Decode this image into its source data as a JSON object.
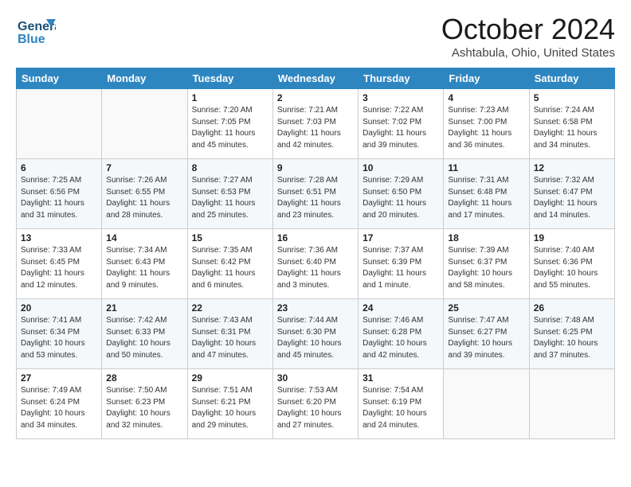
{
  "header": {
    "logo_line1": "General",
    "logo_line2": "Blue",
    "month": "October 2024",
    "location": "Ashtabula, Ohio, United States"
  },
  "weekdays": [
    "Sunday",
    "Monday",
    "Tuesday",
    "Wednesday",
    "Thursday",
    "Friday",
    "Saturday"
  ],
  "weeks": [
    [
      {
        "day": "",
        "sunrise": "",
        "sunset": "",
        "daylight": ""
      },
      {
        "day": "",
        "sunrise": "",
        "sunset": "",
        "daylight": ""
      },
      {
        "day": "1",
        "sunrise": "Sunrise: 7:20 AM",
        "sunset": "Sunset: 7:05 PM",
        "daylight": "Daylight: 11 hours and 45 minutes."
      },
      {
        "day": "2",
        "sunrise": "Sunrise: 7:21 AM",
        "sunset": "Sunset: 7:03 PM",
        "daylight": "Daylight: 11 hours and 42 minutes."
      },
      {
        "day": "3",
        "sunrise": "Sunrise: 7:22 AM",
        "sunset": "Sunset: 7:02 PM",
        "daylight": "Daylight: 11 hours and 39 minutes."
      },
      {
        "day": "4",
        "sunrise": "Sunrise: 7:23 AM",
        "sunset": "Sunset: 7:00 PM",
        "daylight": "Daylight: 11 hours and 36 minutes."
      },
      {
        "day": "5",
        "sunrise": "Sunrise: 7:24 AM",
        "sunset": "Sunset: 6:58 PM",
        "daylight": "Daylight: 11 hours and 34 minutes."
      }
    ],
    [
      {
        "day": "6",
        "sunrise": "Sunrise: 7:25 AM",
        "sunset": "Sunset: 6:56 PM",
        "daylight": "Daylight: 11 hours and 31 minutes."
      },
      {
        "day": "7",
        "sunrise": "Sunrise: 7:26 AM",
        "sunset": "Sunset: 6:55 PM",
        "daylight": "Daylight: 11 hours and 28 minutes."
      },
      {
        "day": "8",
        "sunrise": "Sunrise: 7:27 AM",
        "sunset": "Sunset: 6:53 PM",
        "daylight": "Daylight: 11 hours and 25 minutes."
      },
      {
        "day": "9",
        "sunrise": "Sunrise: 7:28 AM",
        "sunset": "Sunset: 6:51 PM",
        "daylight": "Daylight: 11 hours and 23 minutes."
      },
      {
        "day": "10",
        "sunrise": "Sunrise: 7:29 AM",
        "sunset": "Sunset: 6:50 PM",
        "daylight": "Daylight: 11 hours and 20 minutes."
      },
      {
        "day": "11",
        "sunrise": "Sunrise: 7:31 AM",
        "sunset": "Sunset: 6:48 PM",
        "daylight": "Daylight: 11 hours and 17 minutes."
      },
      {
        "day": "12",
        "sunrise": "Sunrise: 7:32 AM",
        "sunset": "Sunset: 6:47 PM",
        "daylight": "Daylight: 11 hours and 14 minutes."
      }
    ],
    [
      {
        "day": "13",
        "sunrise": "Sunrise: 7:33 AM",
        "sunset": "Sunset: 6:45 PM",
        "daylight": "Daylight: 11 hours and 12 minutes."
      },
      {
        "day": "14",
        "sunrise": "Sunrise: 7:34 AM",
        "sunset": "Sunset: 6:43 PM",
        "daylight": "Daylight: 11 hours and 9 minutes."
      },
      {
        "day": "15",
        "sunrise": "Sunrise: 7:35 AM",
        "sunset": "Sunset: 6:42 PM",
        "daylight": "Daylight: 11 hours and 6 minutes."
      },
      {
        "day": "16",
        "sunrise": "Sunrise: 7:36 AM",
        "sunset": "Sunset: 6:40 PM",
        "daylight": "Daylight: 11 hours and 3 minutes."
      },
      {
        "day": "17",
        "sunrise": "Sunrise: 7:37 AM",
        "sunset": "Sunset: 6:39 PM",
        "daylight": "Daylight: 11 hours and 1 minute."
      },
      {
        "day": "18",
        "sunrise": "Sunrise: 7:39 AM",
        "sunset": "Sunset: 6:37 PM",
        "daylight": "Daylight: 10 hours and 58 minutes."
      },
      {
        "day": "19",
        "sunrise": "Sunrise: 7:40 AM",
        "sunset": "Sunset: 6:36 PM",
        "daylight": "Daylight: 10 hours and 55 minutes."
      }
    ],
    [
      {
        "day": "20",
        "sunrise": "Sunrise: 7:41 AM",
        "sunset": "Sunset: 6:34 PM",
        "daylight": "Daylight: 10 hours and 53 minutes."
      },
      {
        "day": "21",
        "sunrise": "Sunrise: 7:42 AM",
        "sunset": "Sunset: 6:33 PM",
        "daylight": "Daylight: 10 hours and 50 minutes."
      },
      {
        "day": "22",
        "sunrise": "Sunrise: 7:43 AM",
        "sunset": "Sunset: 6:31 PM",
        "daylight": "Daylight: 10 hours and 47 minutes."
      },
      {
        "day": "23",
        "sunrise": "Sunrise: 7:44 AM",
        "sunset": "Sunset: 6:30 PM",
        "daylight": "Daylight: 10 hours and 45 minutes."
      },
      {
        "day": "24",
        "sunrise": "Sunrise: 7:46 AM",
        "sunset": "Sunset: 6:28 PM",
        "daylight": "Daylight: 10 hours and 42 minutes."
      },
      {
        "day": "25",
        "sunrise": "Sunrise: 7:47 AM",
        "sunset": "Sunset: 6:27 PM",
        "daylight": "Daylight: 10 hours and 39 minutes."
      },
      {
        "day": "26",
        "sunrise": "Sunrise: 7:48 AM",
        "sunset": "Sunset: 6:25 PM",
        "daylight": "Daylight: 10 hours and 37 minutes."
      }
    ],
    [
      {
        "day": "27",
        "sunrise": "Sunrise: 7:49 AM",
        "sunset": "Sunset: 6:24 PM",
        "daylight": "Daylight: 10 hours and 34 minutes."
      },
      {
        "day": "28",
        "sunrise": "Sunrise: 7:50 AM",
        "sunset": "Sunset: 6:23 PM",
        "daylight": "Daylight: 10 hours and 32 minutes."
      },
      {
        "day": "29",
        "sunrise": "Sunrise: 7:51 AM",
        "sunset": "Sunset: 6:21 PM",
        "daylight": "Daylight: 10 hours and 29 minutes."
      },
      {
        "day": "30",
        "sunrise": "Sunrise: 7:53 AM",
        "sunset": "Sunset: 6:20 PM",
        "daylight": "Daylight: 10 hours and 27 minutes."
      },
      {
        "day": "31",
        "sunrise": "Sunrise: 7:54 AM",
        "sunset": "Sunset: 6:19 PM",
        "daylight": "Daylight: 10 hours and 24 minutes."
      },
      {
        "day": "",
        "sunrise": "",
        "sunset": "",
        "daylight": ""
      },
      {
        "day": "",
        "sunrise": "",
        "sunset": "",
        "daylight": ""
      }
    ]
  ]
}
